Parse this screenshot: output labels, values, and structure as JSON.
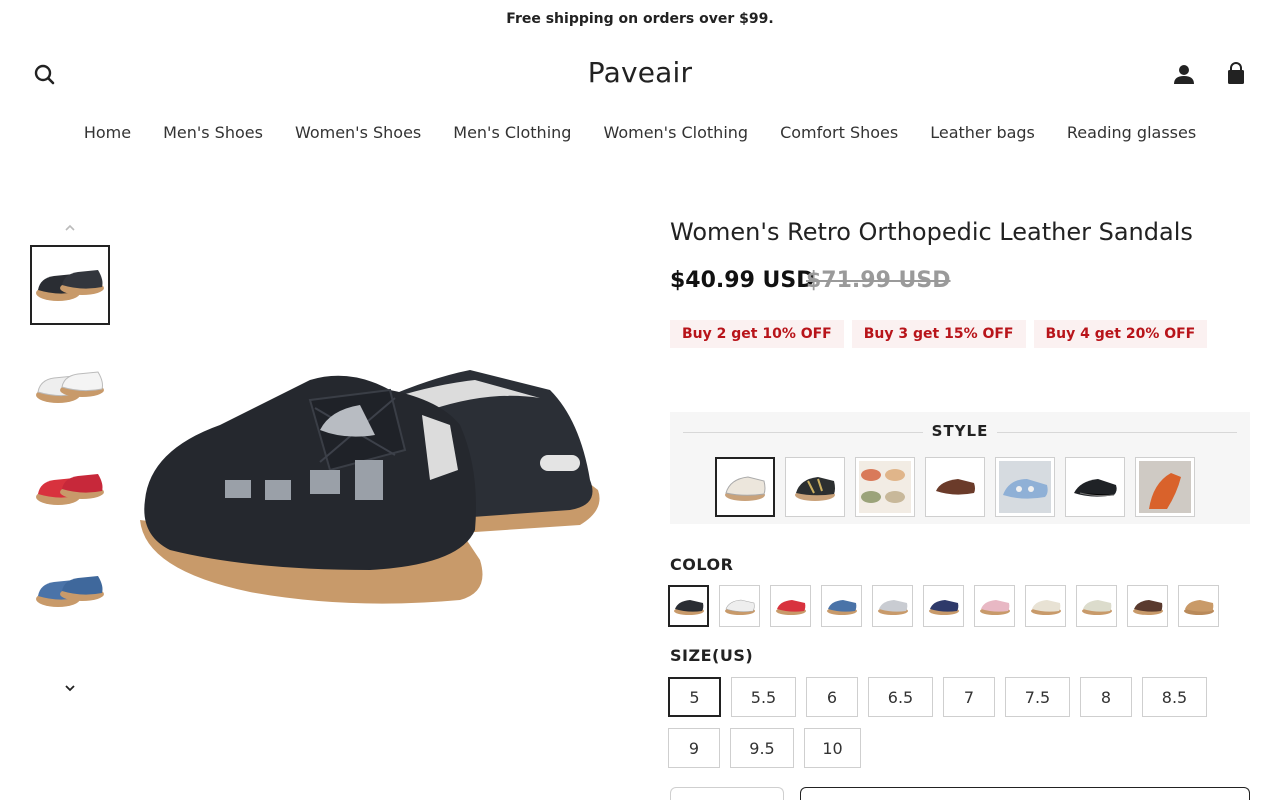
{
  "announcement": "Free shipping on orders over $99.",
  "header": {
    "logo": "Paveair",
    "icons": [
      "search-icon",
      "account-icon",
      "cart-icon"
    ]
  },
  "nav": [
    "Home",
    "Men's Shoes",
    "Women's Shoes",
    "Men's Clothing",
    "Women's Clothing",
    "Comfort Shoes",
    "Leather bags",
    "Reading glasses"
  ],
  "product": {
    "title": "Women's Retro Orthopedic Leather Sandals",
    "price": "$40.99 USD",
    "compare_price": "$71.99 USD",
    "offers": [
      "Buy 2 get 10% OFF",
      "Buy 3 get 15% OFF",
      "Buy 4 get 20% OFF"
    ],
    "style_label": "STYLE",
    "color_label": "COLOR",
    "size_label": "SIZE(US)",
    "sizes_row1": [
      "5",
      "5.5",
      "6",
      "6.5",
      "7",
      "7.5",
      "8",
      "8.5"
    ],
    "sizes_row2": [
      "9",
      "9.5",
      "10"
    ],
    "selected_size": "5",
    "colors": {
      "black": "#2a2d33",
      "white": "#eeeeee",
      "red": "#d8323e",
      "blue": "#4a73a8",
      "sole": "#c89a6a"
    }
  }
}
